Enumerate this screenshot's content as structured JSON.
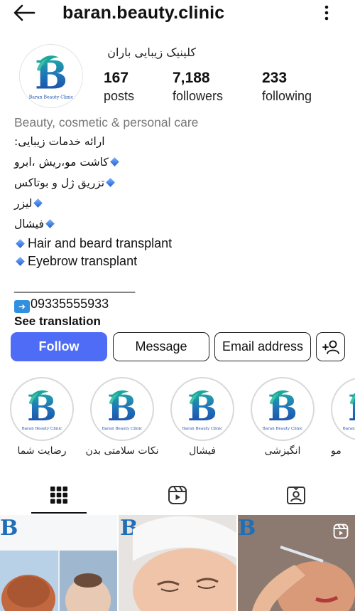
{
  "header": {
    "username": "baran.beauty.clinic",
    "back_icon": "arrow-left-icon",
    "more_icon": "more-vertical-icon"
  },
  "profile": {
    "display_name": "کلینیک زیبایی باران",
    "logo_text": "Baran Beauty Clinic",
    "stats": {
      "posts": {
        "value": "167",
        "label": "posts"
      },
      "followers": {
        "value": "7,188",
        "label": "followers"
      },
      "following": {
        "value": "233",
        "label": "following"
      }
    }
  },
  "bio": {
    "category": "Beauty, cosmetic & personal care",
    "intro": "ارائه خدمات زیبایی:",
    "services_fa": [
      "کاشت مو،ریش ،ابرو",
      "تزریق ژل و بوتاکس",
      "لیزر",
      "فیشال"
    ],
    "services_en": [
      "Hair and beard transplant",
      "Eyebrow transplant"
    ],
    "divider": "__________________",
    "phone": "09335555933",
    "see_translation": "See translation"
  },
  "actions": {
    "follow": "Follow",
    "message": "Message",
    "email": "Email address",
    "add_user_icon": "add-user-icon"
  },
  "highlights": [
    {
      "label": "رضایت شما"
    },
    {
      "label": "نکات سلامتی بدن"
    },
    {
      "label": "فیشال"
    },
    {
      "label": "انگیزشی"
    },
    {
      "label": "مو"
    }
  ],
  "tabs": [
    {
      "name": "grid",
      "icon": "grid-icon",
      "active": true
    },
    {
      "name": "reels",
      "icon": "reels-icon",
      "active": false
    },
    {
      "name": "tagged",
      "icon": "tagged-user-icon",
      "active": false
    }
  ],
  "colors": {
    "follow_button": "#4f6cf7",
    "brand_teal": "#1ba89b",
    "brand_blue": "#1e4fa8"
  }
}
